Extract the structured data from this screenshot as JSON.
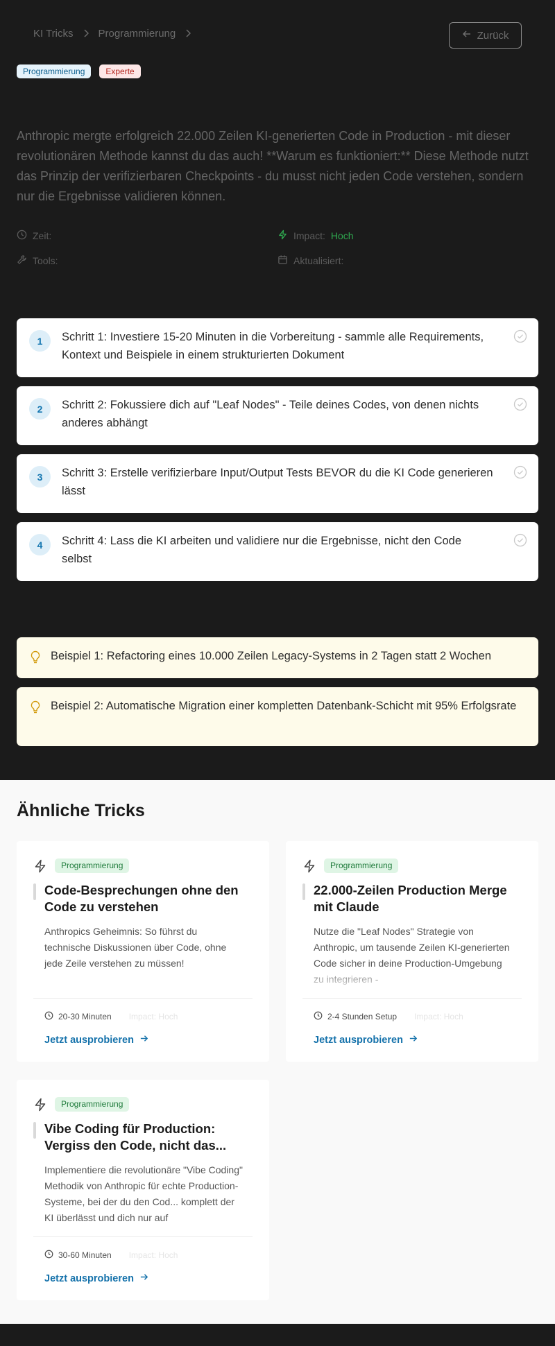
{
  "breadcrumb": {
    "items": [
      "KI Tricks",
      "Programmierung"
    ]
  },
  "back_button": {
    "label": "Zurück"
  },
  "badges": {
    "category": "Programmierung",
    "level": "Experte"
  },
  "description": "Anthropic mergte erfolgreich 22.000 Zeilen KI-generierten Code in Production - mit dieser revolutionären Methode kannst du das auch! **Warum es funktioniert:** Diese Methode nutzt das Prinzip der verifizierbaren Checkpoints - du musst nicht jeden Code verstehen, sondern nur die Ergebnisse validieren können.",
  "meta": {
    "time_label": "Zeit:",
    "impact_label": "Impact:",
    "impact_value": "Hoch",
    "tools_label": "Tools:",
    "updated_label": "Aktualisiert:"
  },
  "steps": [
    {
      "num": "1",
      "text": "Schritt 1: Investiere 15-20 Minuten in die Vorbereitung - sammle alle Requirements, Kontext und Beispiele in einem strukturierten Dokument"
    },
    {
      "num": "2",
      "text": "Schritt 2: Fokussiere dich auf \"Leaf Nodes\" - Teile deines Codes, von denen nichts anderes abhängt"
    },
    {
      "num": "3",
      "text": "Schritt 3: Erstelle verifizierbare Input/Output Tests BEVOR du die KI Code generieren lässt"
    },
    {
      "num": "4",
      "text": "Schritt 4: Lass die KI arbeiten und validiere nur die Ergebnisse, nicht den Code selbst"
    }
  ],
  "examples": [
    "Beispiel 1: Refactoring eines 10.000 Zeilen Legacy-Systems in 2 Tagen statt 2 Wochen",
    "Beispiel 2: Automatische Migration einer kompletten Datenbank-Schicht mit 95% Erfolgsrate"
  ],
  "similar": {
    "heading": "Ähnliche Tricks",
    "cards": [
      {
        "tag": "Programmierung",
        "title": "Code-Besprechungen ohne den Code zu verstehen",
        "desc": "Anthropics Geheimnis: So führst du technische Diskussionen über Code, ohne jede Zeile verstehen zu müssen!",
        "time": "20-30 Minuten",
        "impact": "Impact: Hoch",
        "cta": "Jetzt ausprobieren"
      },
      {
        "tag": "Programmierung",
        "title": "22.000-Zeilen Production Merge mit Claude",
        "desc": "Nutze die \"Leaf Nodes\" Strategie von Anthropic, um tausende Zeilen KI-generierten Code sicher in deine Production-Umgebung zu integrieren -",
        "time": "2-4 Stunden Setup",
        "impact": "Impact: Hoch",
        "cta": "Jetzt ausprobieren"
      },
      {
        "tag": "Programmierung",
        "title": "Vibe Coding für Production: Vergiss den Code, nicht das...",
        "desc": "Implementiere die revolutionäre \"Vibe Coding\" Methodik von Anthropic für echte Production-Systeme, bei der du den Cod... komplett der KI überlässt und dich nur auf",
        "time": "30-60 Minuten",
        "impact": "Impact: Hoch",
        "cta": "Jetzt ausprobieren"
      }
    ]
  },
  "colors": {
    "dark_bg": "#1b1b1b",
    "accent_blue": "#1572ab",
    "impact_green": "#2fa84f",
    "example_bg": "#fefbea"
  }
}
